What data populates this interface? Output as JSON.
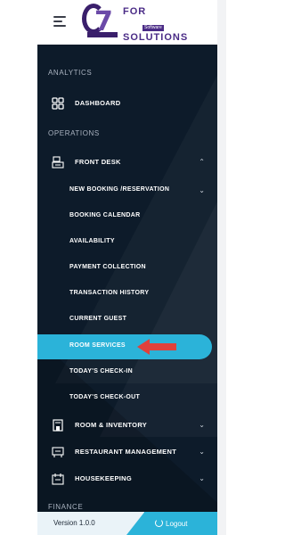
{
  "header": {
    "logo": {
      "brand": "G7",
      "text_top": "FOR",
      "tagline": "Software",
      "text_bottom": "SOLUTIONS"
    }
  },
  "sidebar": {
    "sections": {
      "analytics": "ANALYTICS",
      "operations": "OPERATIONS",
      "finance": "FINANCE"
    },
    "items": [
      {
        "label": "DASHBOARD",
        "icon": "dashboard-grid-icon"
      },
      {
        "label": "FRONT DESK",
        "icon": "front-desk-icon",
        "expanded": true
      },
      {
        "label": "NEW BOOKING /RESERVATION",
        "has_chevron": true
      },
      {
        "label": "BOOKING CALENDAR"
      },
      {
        "label": "AVAILABILITY"
      },
      {
        "label": "PAYMENT COLLECTION"
      },
      {
        "label": "TRANSACTION HISTORY"
      },
      {
        "label": "CURRENT GUEST"
      },
      {
        "label": "ROOM SERVICES",
        "active": true
      },
      {
        "label": "TODAY'S CHECK-IN"
      },
      {
        "label": "TODAY'S CHECK-OUT"
      },
      {
        "label": "ROOM & INVENTORY",
        "icon": "building-icon"
      },
      {
        "label": "RESTAURANT MANAGEMENT",
        "icon": "restaurant-icon"
      },
      {
        "label": "HOUSEKEEPING",
        "icon": "housekeeping-icon"
      }
    ]
  },
  "footer": {
    "version": "Version 1.0.0",
    "logout": "Logout"
  },
  "colors": {
    "sidebar_bg": "#0d1b2a",
    "accent": "#2bb3d9",
    "arrow": "#e0413b",
    "logo_purple": "#4a2b86"
  }
}
